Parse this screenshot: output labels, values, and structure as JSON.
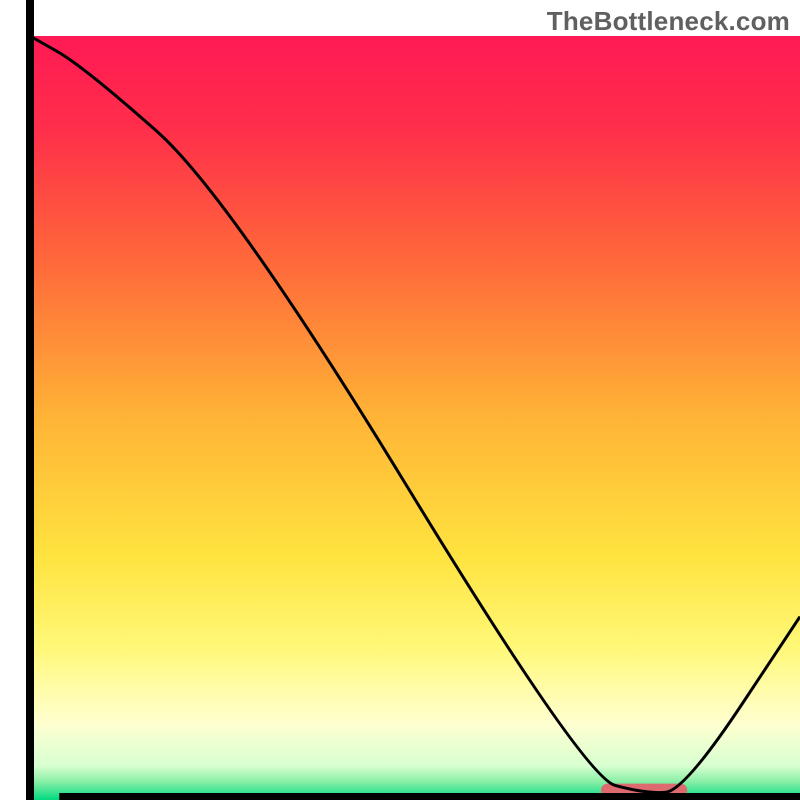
{
  "watermark": {
    "text": "TheBottleneck.com"
  },
  "chart_data": {
    "type": "line",
    "title": "",
    "xlabel": "",
    "ylabel": "",
    "xlim": [
      0,
      100
    ],
    "ylim": [
      0,
      100
    ],
    "background_gradient_stops": [
      {
        "offset": 0,
        "color": "#ff1a55"
      },
      {
        "offset": 0.12,
        "color": "#ff2e4a"
      },
      {
        "offset": 0.3,
        "color": "#ff6a3a"
      },
      {
        "offset": 0.5,
        "color": "#ffb436"
      },
      {
        "offset": 0.68,
        "color": "#ffe33f"
      },
      {
        "offset": 0.8,
        "color": "#fff878"
      },
      {
        "offset": 0.9,
        "color": "#ffffd0"
      },
      {
        "offset": 0.955,
        "color": "#d8ffd0"
      },
      {
        "offset": 0.975,
        "color": "#8df0a8"
      },
      {
        "offset": 1.0,
        "color": "#00d980"
      }
    ],
    "series": [
      {
        "name": "bottleneck-curve",
        "x": [
          0,
          7,
          26,
          72,
          80,
          85,
          100
        ],
        "y": [
          100,
          96,
          79,
          3,
          0.8,
          1.2,
          24
        ]
      }
    ],
    "marker": {
      "name": "optimal-range",
      "x_start": 75,
      "x_end": 84.5,
      "y": 1.3,
      "color": "#dd6a6f",
      "thickness_px": 13
    },
    "axes": {
      "left": {
        "x": 3.8,
        "y0": 0,
        "y1": 100
      },
      "bottom": {
        "y": 0.12,
        "x0": 3.8,
        "x1": 100
      }
    }
  }
}
